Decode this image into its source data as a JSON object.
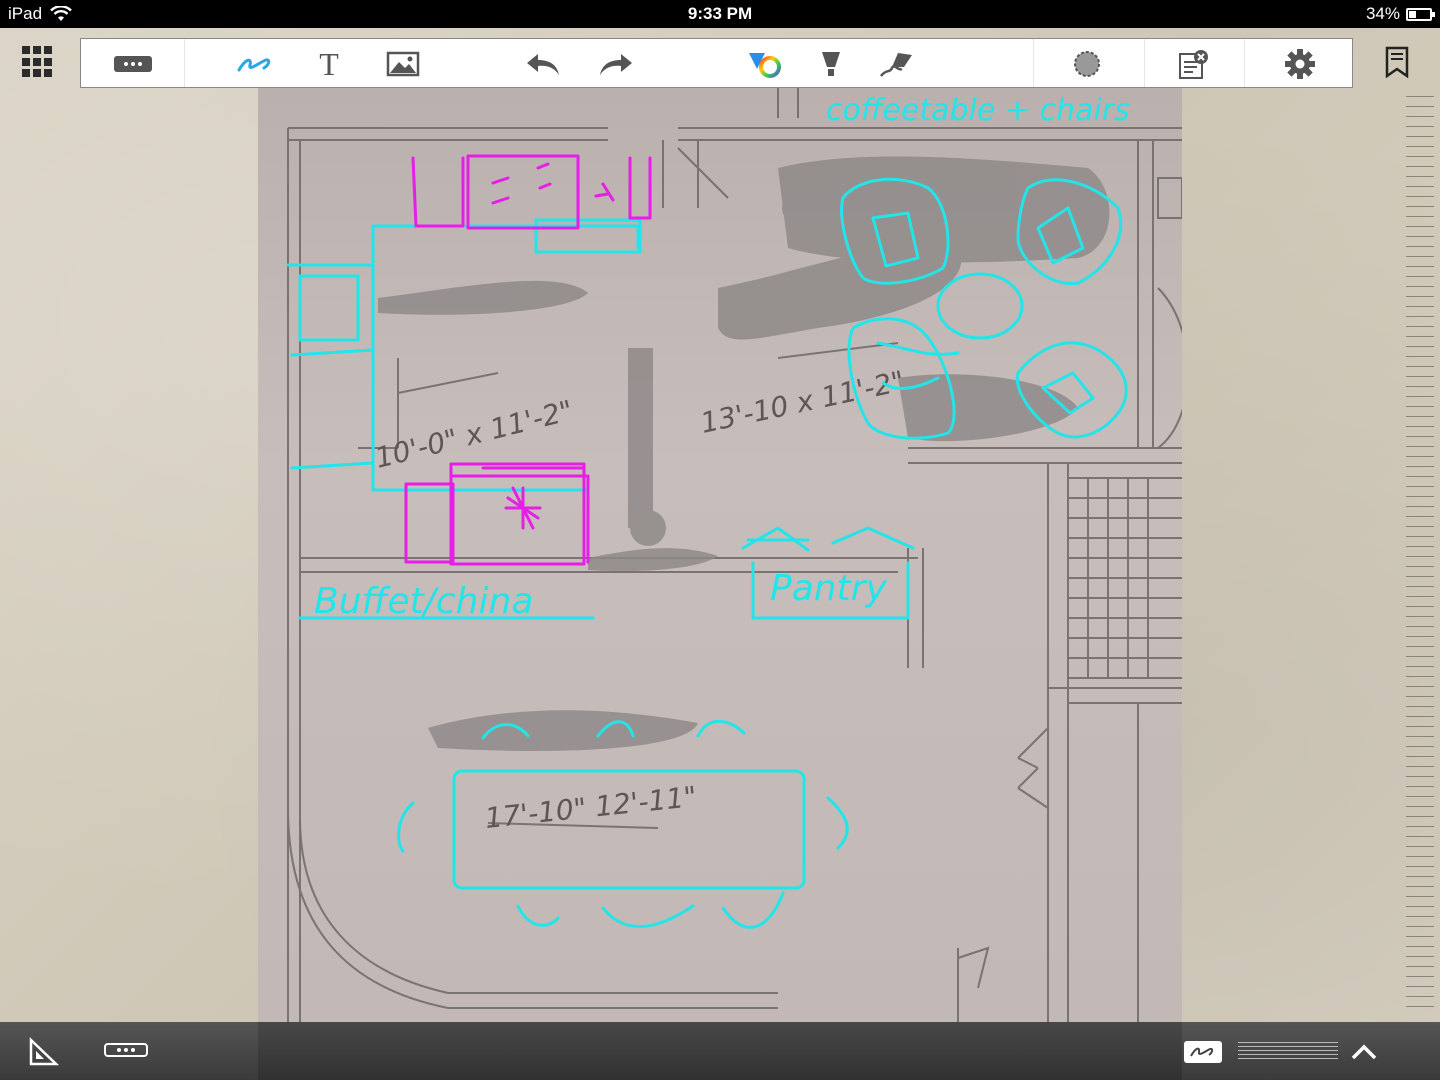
{
  "status_bar": {
    "device": "iPad",
    "time": "9:33 PM",
    "battery_percent": "34%",
    "battery_level": 0.34
  },
  "toolbar": {
    "tools": [
      {
        "name": "menu-tool",
        "icon": "dots-icon"
      },
      {
        "name": "pen-tool",
        "icon": "pen-icon",
        "selected": true
      },
      {
        "name": "text-tool",
        "icon": "text-icon",
        "label": "T"
      },
      {
        "name": "image-tool",
        "icon": "image-icon"
      },
      {
        "name": "undo",
        "icon": "undo-icon"
      },
      {
        "name": "redo",
        "icon": "redo-icon"
      },
      {
        "name": "color-picker",
        "icon": "color-wheel-icon"
      },
      {
        "name": "highlighter-tool",
        "icon": "highlighter-icon"
      },
      {
        "name": "eraser-tool",
        "icon": "eraser-icon"
      },
      {
        "name": "lasso-tool",
        "icon": "lasso-icon"
      },
      {
        "name": "clear-page",
        "icon": "clear-page-icon"
      },
      {
        "name": "settings",
        "icon": "gear-icon"
      }
    ]
  },
  "drawing": {
    "labels": {
      "coffee": "coffeetable + chairs",
      "buffet": "Buffet/china",
      "pantry": "Pantry"
    },
    "plan_labels": {
      "room1": "10'-0\" x 11'-2\"",
      "room2": "13'-10 x 11'-2\"",
      "room3": "17'-10\" 12'-11\""
    },
    "colors": {
      "cyan": "#22e5ea",
      "magenta": "#e61ee6",
      "plan_line": "#6d6766",
      "smudge": "#8f8a89"
    }
  },
  "bottom_bar": {
    "items": [
      "ruler-triangle-icon",
      "dots-pill-icon",
      "pen-mode-icon",
      "line-weight-icon",
      "chevron-up-icon"
    ]
  }
}
